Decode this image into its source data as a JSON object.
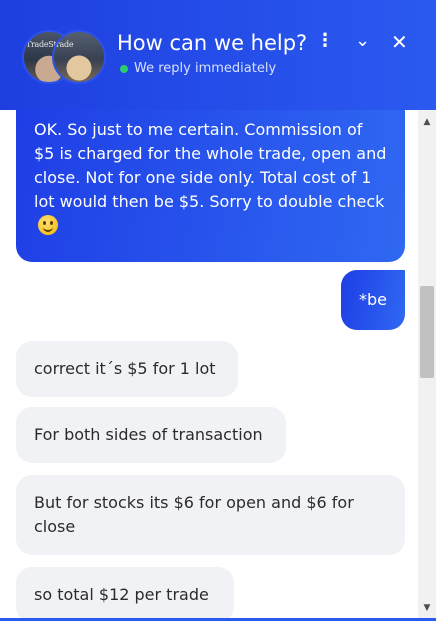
{
  "header": {
    "title": "How can we help?",
    "status": "We reply immediately",
    "avatar_brand": "TradeStreet",
    "avatar_brand_2": "rade",
    "menu_icon": "⋮",
    "minimize_icon": "⌄",
    "close_icon": "✕"
  },
  "messages": [
    {
      "from": "user",
      "text": "OK. So just to me certain. Commission of $5 is charged for the whole trade, open and close. Not for one side only. Total cost of 1 lot would then be $5. Sorry to double check",
      "emoji": "slightly-smiling-face"
    },
    {
      "from": "user",
      "text": "*be"
    },
    {
      "from": "agent",
      "text": "correct it´s  $5 for 1 lot"
    },
    {
      "from": "agent",
      "text": "For both sides of transaction"
    },
    {
      "from": "agent",
      "text": "But for stocks its  $6 for open and  $6 for close"
    },
    {
      "from": "agent",
      "text": "so total  $12 per trade"
    }
  ],
  "scroll": {
    "up_icon": "▲",
    "down_icon": "▼"
  },
  "colors": {
    "accent": "#2b5af0",
    "incoming_bg": "#f1f2f6",
    "online": "#2ecc71"
  }
}
